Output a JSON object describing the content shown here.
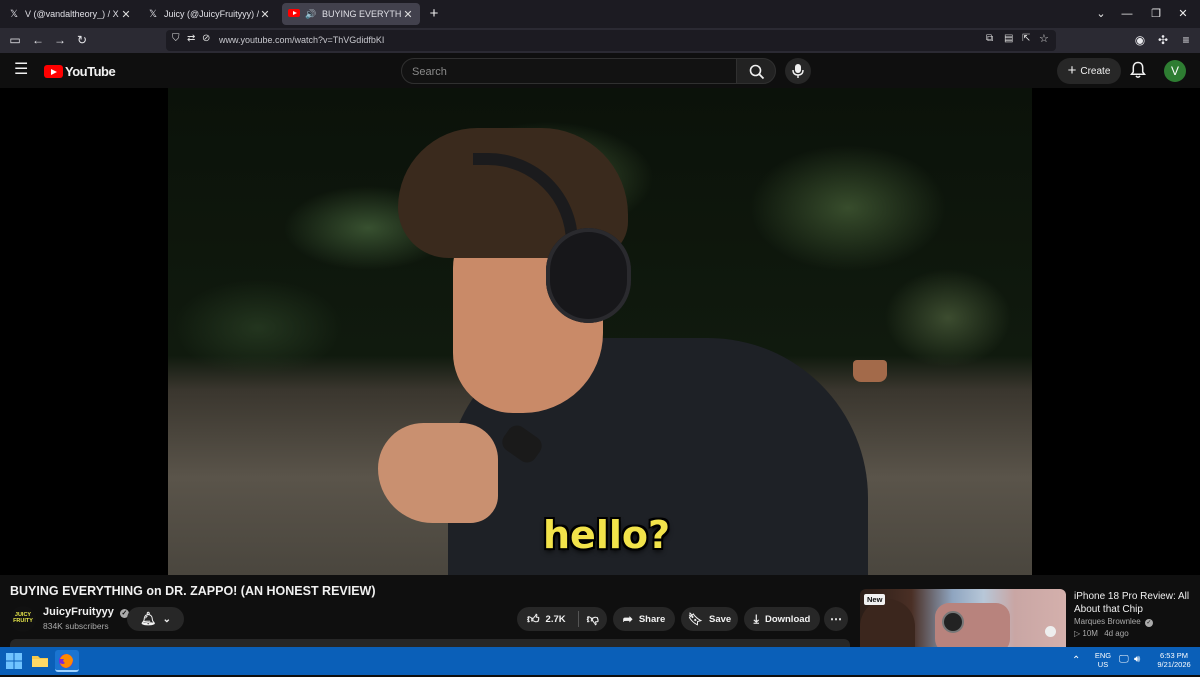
{
  "browser": {
    "tabs": [
      {
        "title": "V (@vandaltheory_) / X",
        "icon": "x-logo-icon"
      },
      {
        "title": "Juicy (@JuicyFruityyy) / X",
        "icon": "x-logo-icon"
      },
      {
        "title": "BUYING EVERYTHING on DR. ZAPPO! (AN HONEST REVIEW)",
        "icon": "youtube-favicon",
        "active": true
      }
    ],
    "url": "www.youtube.com/watch?v=ThVGdidfbKI"
  },
  "youtube": {
    "logo_text": "YouTube",
    "search_placeholder": "Search",
    "create_label": "Create",
    "avatar_letter": "V"
  },
  "video": {
    "subtitle": "hello?",
    "title": "BUYING EVERYTHING on DR. ZAPPO! (AN HONEST REVIEW)",
    "channel": {
      "name": "JuicyFruityyy",
      "subscribers": "834K subscribers",
      "logo_text": "JUICY FRUITY"
    },
    "likes": "2.7K",
    "share_label": "Share",
    "save_label": "Save",
    "download_label": "Download"
  },
  "recommendation": {
    "badge": "New",
    "title": "iPhone 18 Pro Review: All About that Chip",
    "channel": "Marques Brownlee",
    "views": "10M",
    "age": "4d ago"
  },
  "taskbar": {
    "lang_top": "ENG",
    "lang_bottom": "US",
    "time": "6:53 PM",
    "date": "9/21/2026"
  },
  "colors": {
    "yt_red": "#ff0000",
    "taskbar_blue": "#0a5fb8",
    "subtitle_yellow": "#f2e34a"
  }
}
